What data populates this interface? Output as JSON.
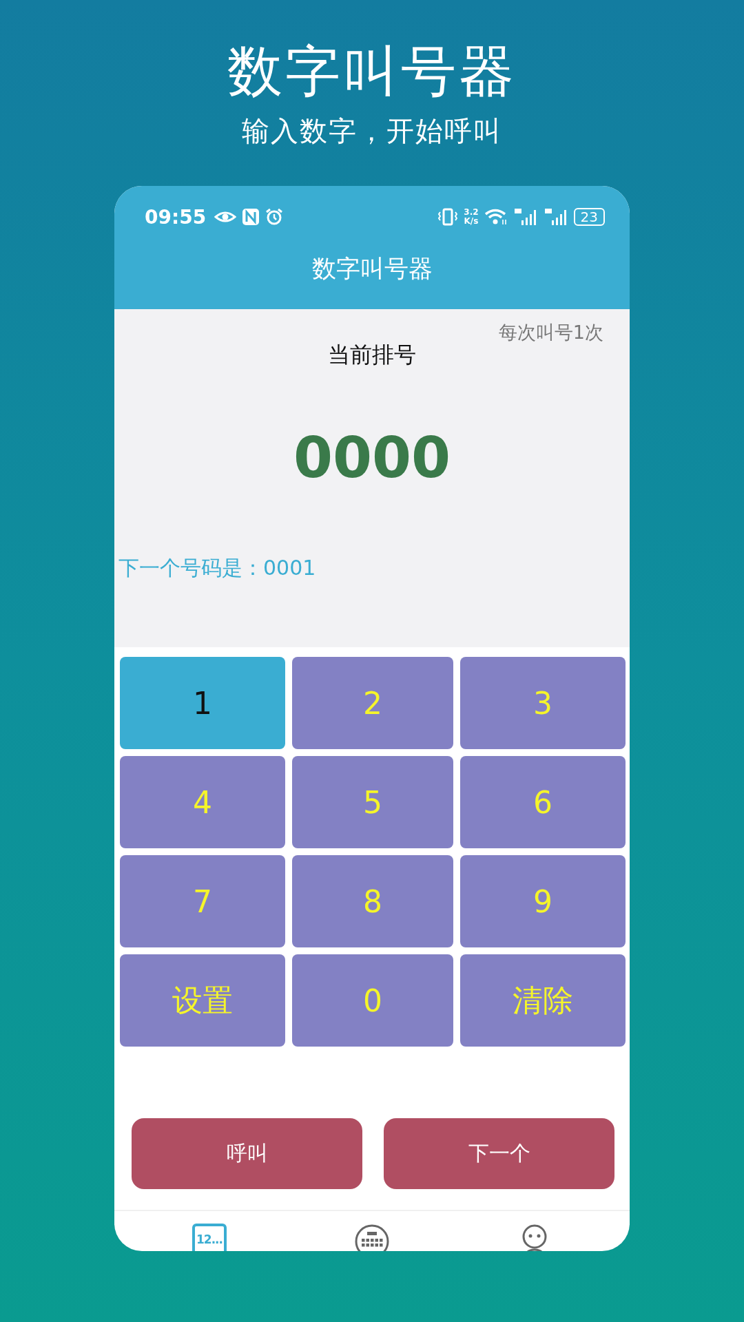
{
  "promo": {
    "title": "数字叫号器",
    "subtitle": "输入数字，开始呼叫"
  },
  "status_bar": {
    "time": "09:55",
    "speed_value": "3.2",
    "speed_unit": "K/s",
    "battery": "23"
  },
  "app_bar": {
    "title": "数字叫号器"
  },
  "display": {
    "repeat_note": "每次叫号1次",
    "label": "当前排号",
    "current_number": "0000",
    "next_number": "下一个号码是：0001"
  },
  "keypad": [
    {
      "label": "1",
      "selected": true
    },
    {
      "label": "2",
      "selected": false
    },
    {
      "label": "3",
      "selected": false
    },
    {
      "label": "4",
      "selected": false
    },
    {
      "label": "5",
      "selected": false
    },
    {
      "label": "6",
      "selected": false
    },
    {
      "label": "7",
      "selected": false
    },
    {
      "label": "8",
      "selected": false
    },
    {
      "label": "9",
      "selected": false
    },
    {
      "label": "设置",
      "selected": false
    },
    {
      "label": "0",
      "selected": false
    },
    {
      "label": "清除",
      "selected": false
    }
  ],
  "actions": [
    "呼叫",
    "下一个"
  ],
  "bottom_nav": [
    {
      "kind": "numbers",
      "label": "12...",
      "selected": true
    },
    {
      "kind": "keypad",
      "selected": false
    },
    {
      "kind": "person",
      "selected": false
    }
  ]
}
